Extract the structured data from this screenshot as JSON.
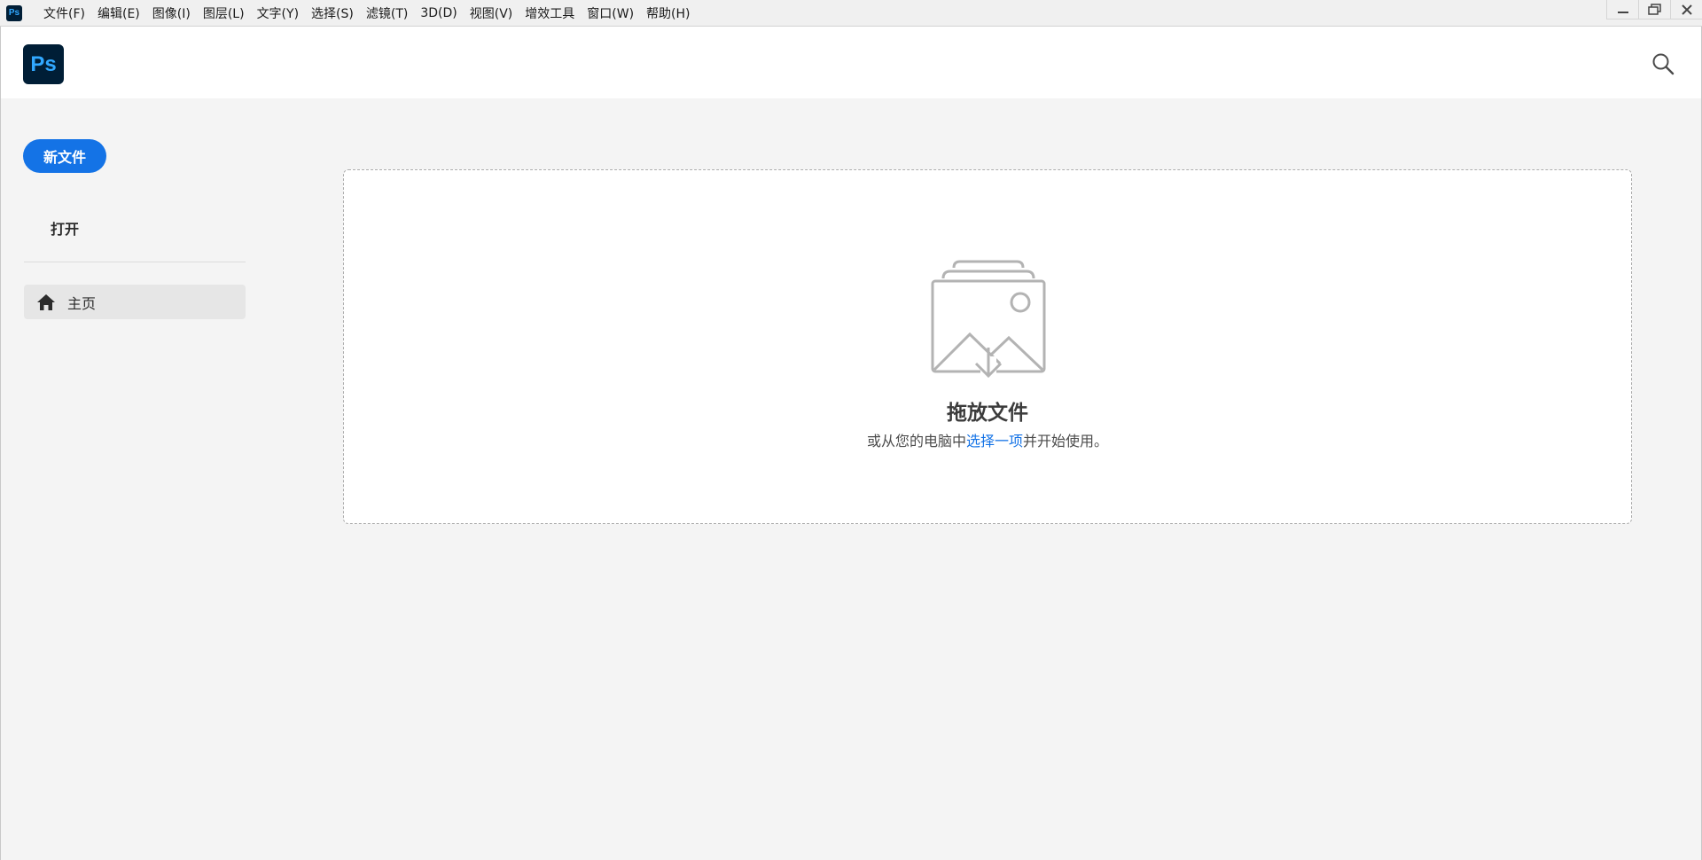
{
  "menubar": {
    "app_icon_text": "Ps",
    "items": [
      {
        "label": "文件(F)"
      },
      {
        "label": "编辑(E)"
      },
      {
        "label": "图像(I)"
      },
      {
        "label": "图层(L)"
      },
      {
        "label": "文字(Y)"
      },
      {
        "label": "选择(S)"
      },
      {
        "label": "滤镜(T)"
      },
      {
        "label": "3D(D)"
      },
      {
        "label": "视图(V)"
      },
      {
        "label": "增效工具"
      },
      {
        "label": "窗口(W)"
      },
      {
        "label": "帮助(H)"
      }
    ],
    "window_controls": [
      "minimize-icon",
      "restore-icon",
      "close-icon"
    ]
  },
  "header": {
    "logo_text": "Ps",
    "search_icon": "search-icon"
  },
  "sidebar": {
    "new_file_label": "新文件",
    "open_label": "打开",
    "nav_items": [
      {
        "label": "主页",
        "icon": "home-icon",
        "selected": true
      }
    ]
  },
  "dropzone": {
    "icon": "image-stack-download-icon",
    "title": "拖放文件",
    "subtitle_prefix": "或从您的电脑中",
    "subtitle_link": "选择一项",
    "subtitle_suffix": "并开始使用。"
  },
  "colors": {
    "accent": "#1473e6",
    "logo_bg": "#001e36",
    "logo_fg": "#31a8ff",
    "page_bg": "#f4f4f4",
    "header_bg": "#ffffff",
    "nav_selected_bg": "#e6e6e6"
  }
}
